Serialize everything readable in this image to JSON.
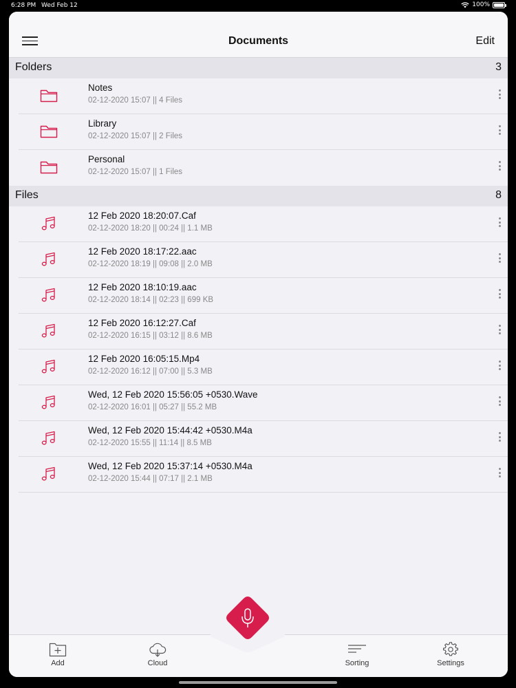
{
  "status_bar": {
    "time": "6:28 PM",
    "date": "Wed Feb 12",
    "battery": "100%"
  },
  "navbar": {
    "title": "Documents",
    "edit_label": "Edit"
  },
  "folders": {
    "title": "Folders",
    "count": "3",
    "items": [
      {
        "name": "Notes",
        "meta": "02-12-2020 15:07 || 4 Files"
      },
      {
        "name": "Library",
        "meta": "02-12-2020 15:07 || 2 Files"
      },
      {
        "name": "Personal",
        "meta": "02-12-2020 15:07 || 1 Files"
      }
    ]
  },
  "files": {
    "title": "Files",
    "count": "8",
    "items": [
      {
        "name": "12 Feb 2020 18:20:07.Caf",
        "meta": "02-12-2020 18:20 || 00:24 || 1.1 MB"
      },
      {
        "name": "12 Feb 2020 18:17:22.aac",
        "meta": "02-12-2020 18:19 || 09:08 || 2.0 MB"
      },
      {
        "name": "12 Feb 2020 18:10:19.aac",
        "meta": "02-12-2020 18:14 || 02:23 || 699 KB"
      },
      {
        "name": "12 Feb 2020 16:12:27.Caf",
        "meta": "02-12-2020 16:15 || 03:12 || 8.6 MB"
      },
      {
        "name": "12 Feb 2020 16:05:15.Mp4",
        "meta": "02-12-2020 16:12 || 07:00 || 5.3 MB"
      },
      {
        "name": "Wed, 12 Feb 2020 15:56:05 +0530.Wave",
        "meta": "02-12-2020 16:01 || 05:27 || 55.2 MB"
      },
      {
        "name": "Wed, 12 Feb 2020 15:44:42 +0530.M4a",
        "meta": "02-12-2020 15:55 || 11:14 || 8.5 MB"
      },
      {
        "name": "Wed, 12 Feb 2020 15:37:14 +0530.M4a",
        "meta": "02-12-2020 15:44 || 07:17 || 2.1 MB"
      }
    ]
  },
  "tabbar": {
    "add_label": "Add",
    "cloud_label": "Cloud",
    "sorting_label": "Sorting",
    "settings_label": "Settings"
  },
  "colors": {
    "accent": "#d61d4b",
    "background": "#f2f1f6",
    "header": "#e4e3e9"
  },
  "icons": {
    "folder": "folder-icon",
    "file": "music-note-icon",
    "more": "more-vertical-icon",
    "record": "microphone-icon"
  }
}
